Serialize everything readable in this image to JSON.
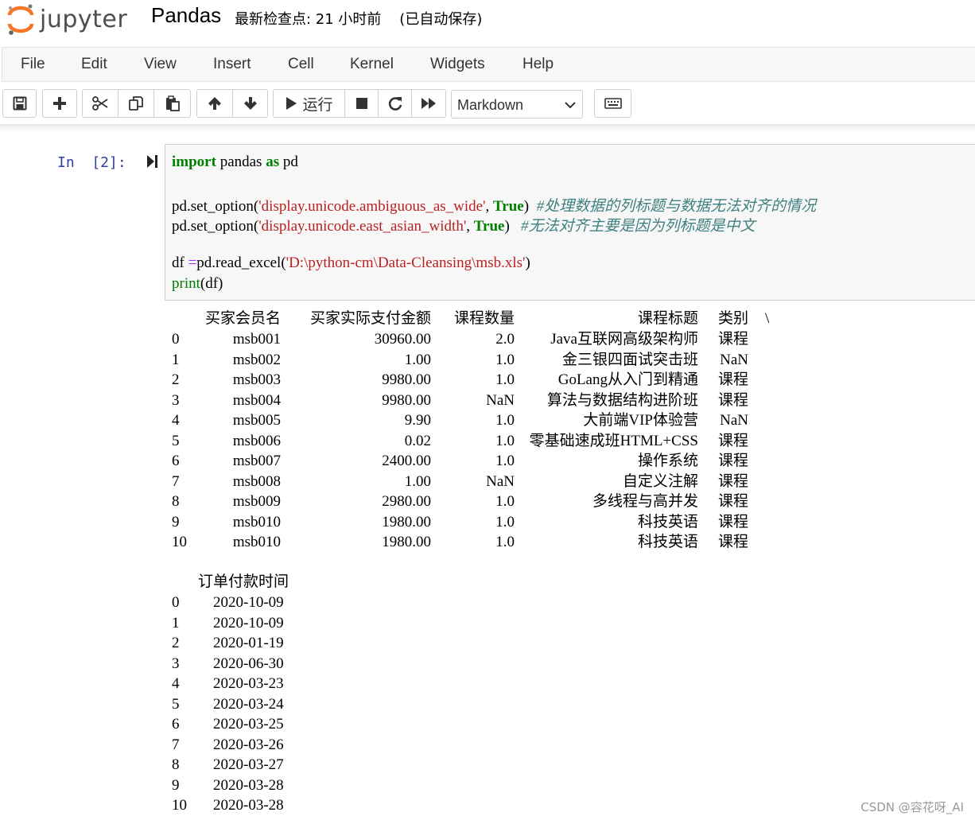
{
  "header": {
    "logo_text": "jupyter",
    "notebook_title": "Pandas",
    "checkpoint_text": "最新检查点: 21 小时前    (已自动保存)"
  },
  "menu": [
    "File",
    "Edit",
    "View",
    "Insert",
    "Cell",
    "Kernel",
    "Widgets",
    "Help"
  ],
  "toolbar": {
    "run_label": "运行",
    "cell_type": "Markdown",
    "icons": [
      "save-icon",
      "plus-icon",
      "cut-icon",
      "copy-icon",
      "paste-icon",
      "arrow-up-icon",
      "arrow-down-icon",
      "play-icon",
      "stop-icon",
      "restart-icon",
      "fast-forward-icon",
      "keyboard-icon"
    ]
  },
  "cell": {
    "prompt": "In  [2]:",
    "code": {
      "l1_kw1": "import",
      "l1_mid": " pandas ",
      "l1_kw2": "as",
      "l1_end": " pd",
      "l3_a": "pd.set_option(",
      "l3_str": "'display.unicode.ambiguous_as_wide'",
      "l3_b": ", ",
      "l3_true": "True",
      "l3_c": ")  ",
      "l3_cm": "#处理数据的列标题与数据无法对齐的情况",
      "l4_a": "pd.set_option(",
      "l4_str": "'display.unicode.east_asian_width'",
      "l4_b": ", ",
      "l4_true": "True",
      "l4_c": ")   ",
      "l4_cm": "#无法对齐主要是因为列标题是中文",
      "l6_a": "df ",
      "l6_op": "=",
      "l6_b": "pd.read_excel(",
      "l6_str": "'D:\\python-cm\\Data-Cleansing\\msb.xls'",
      "l6_c": ")",
      "l7_print": "print",
      "l7_b": "(df)"
    }
  },
  "output": {
    "table1": {
      "headers": [
        "买家会员名",
        "买家实际支付金额",
        "课程数量",
        "课程标题",
        "类别",
        "\\"
      ],
      "rows": [
        [
          "0",
          "msb001",
          "30960.00",
          "2.0",
          "Java互联网高级架构师",
          "课程"
        ],
        [
          "1",
          "msb002",
          "1.00",
          "1.0",
          "金三银四面试突击班",
          "NaN"
        ],
        [
          "2",
          "msb003",
          "9980.00",
          "1.0",
          "GoLang从入门到精通",
          "课程"
        ],
        [
          "3",
          "msb004",
          "9980.00",
          "NaN",
          "算法与数据结构进阶班",
          "课程"
        ],
        [
          "4",
          "msb005",
          "9.90",
          "1.0",
          "大前端VIP体验营",
          "NaN"
        ],
        [
          "5",
          "msb006",
          "0.02",
          "1.0",
          "零基础速成班HTML+CSS",
          "课程"
        ],
        [
          "6",
          "msb007",
          "2400.00",
          "1.0",
          "操作系统",
          "课程"
        ],
        [
          "7",
          "msb008",
          "1.00",
          "NaN",
          "自定义注解",
          "课程"
        ],
        [
          "8",
          "msb009",
          "2980.00",
          "1.0",
          "多线程与高并发",
          "课程"
        ],
        [
          "9",
          "msb010",
          "1980.00",
          "1.0",
          "科技英语",
          "课程"
        ],
        [
          "10",
          "msb010",
          "1980.00",
          "1.0",
          "科技英语",
          "课程"
        ]
      ]
    },
    "table2": {
      "header": "订单付款时间",
      "rows": [
        [
          "0",
          "2020-10-09"
        ],
        [
          "1",
          "2020-10-09"
        ],
        [
          "2",
          "2020-01-19"
        ],
        [
          "3",
          "2020-06-30"
        ],
        [
          "4",
          "2020-03-23"
        ],
        [
          "5",
          "2020-03-24"
        ],
        [
          "6",
          "2020-03-25"
        ],
        [
          "7",
          "2020-03-26"
        ],
        [
          "8",
          "2020-03-27"
        ],
        [
          "9",
          "2020-03-28"
        ],
        [
          "10",
          "2020-03-28"
        ]
      ]
    }
  },
  "watermark": "CSDN @容花呀_AI"
}
